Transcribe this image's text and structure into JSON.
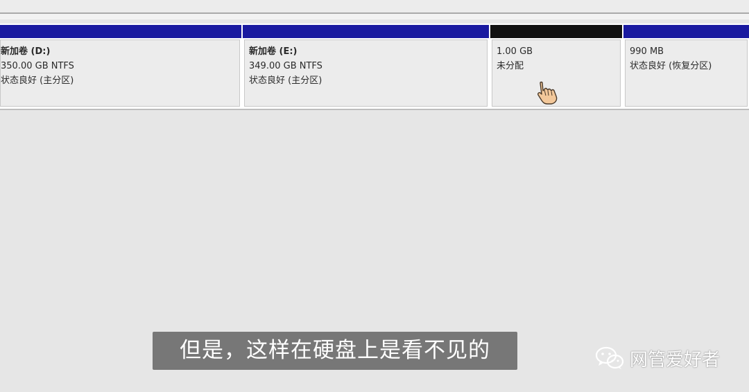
{
  "partitions": [
    {
      "name": "新加卷 (D:)",
      "size": "350.00 GB NTFS",
      "status": "状态良好 (主分区)"
    },
    {
      "name": "新加卷 (E:)",
      "size": "349.00 GB NTFS",
      "status": "状态良好 (主分区)"
    },
    {
      "name": "",
      "size": "1.00 GB",
      "status": "未分配"
    },
    {
      "name": "",
      "size": "990 MB",
      "status": "状态良好 (恢复分区)"
    }
  ],
  "colors": {
    "primary_bar": "#1a1aa0",
    "unallocated_bar": "#111111",
    "background": "#e6e6e6"
  },
  "cursor_icon": "hand-pointer-icon",
  "subtitle": "但是，这样在硬盘上是看不见的",
  "watermark": {
    "icon": "wechat-icon",
    "text": "网管爱好者"
  }
}
